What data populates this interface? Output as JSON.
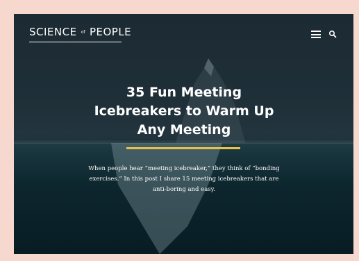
{
  "header": {
    "logo_left": "SCIENCE",
    "logo_small": "of",
    "logo_right": "PEOPLE",
    "menu_icon": "hamburger-menu-icon",
    "search_icon": "search-icon"
  },
  "hero": {
    "title": "35 Fun Meeting Icebreakers to Warm Up Any Meeting",
    "intro": "When people hear “meeting icebreaker,” they think of “bonding exercises.” In this post I share 15 meeting icebreakers that are anti-boring and easy.",
    "accent_color": "#e8c24a"
  },
  "colors": {
    "page_background": "#f6d8cf",
    "hero_background": "#1f2f38"
  }
}
